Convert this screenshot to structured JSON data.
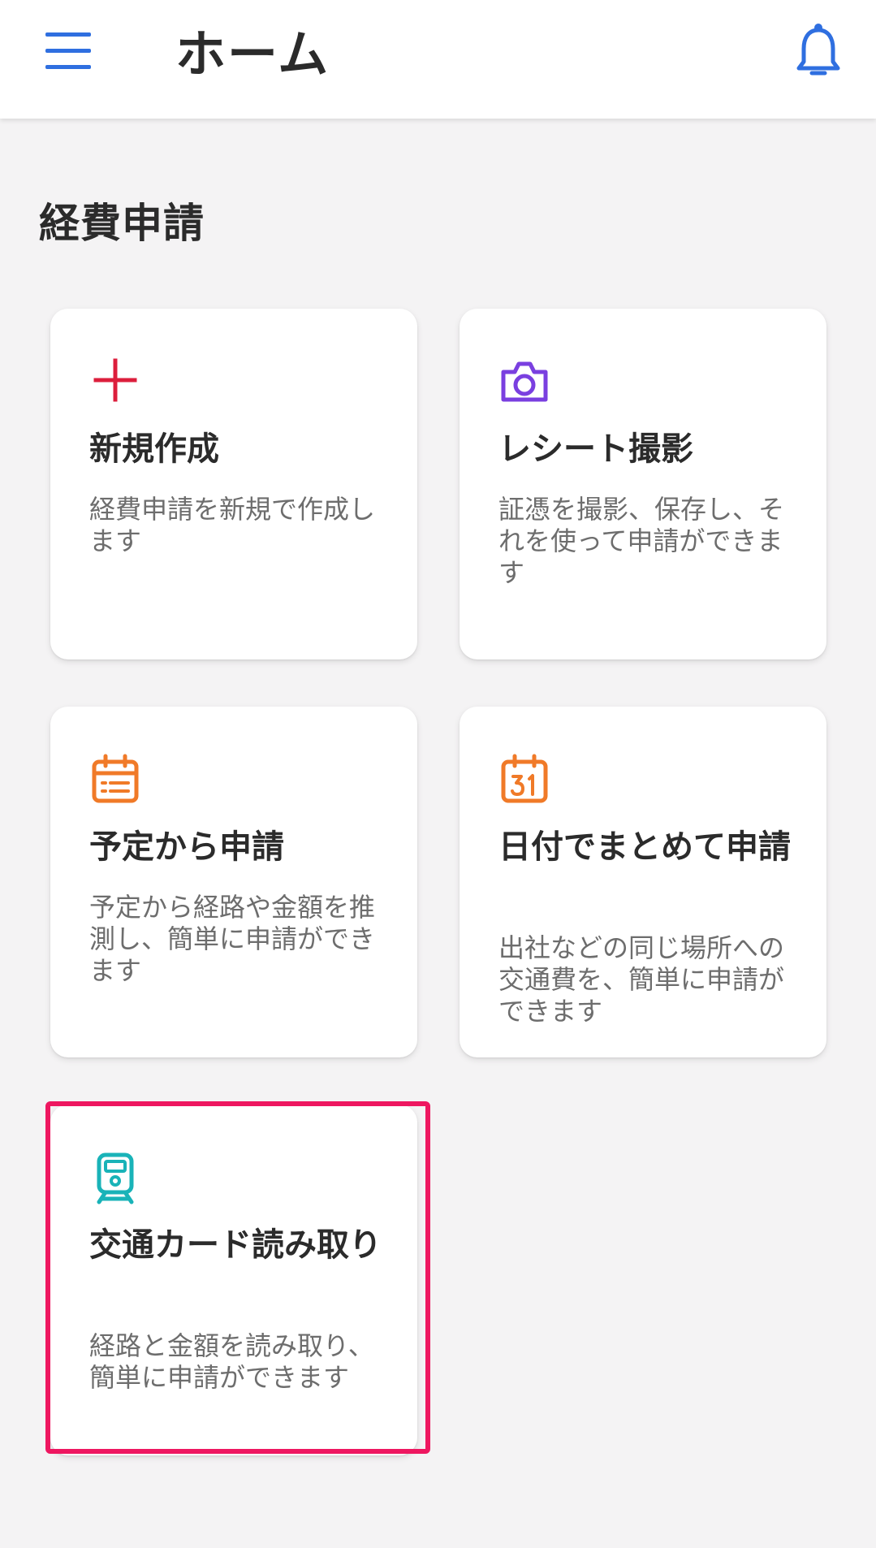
{
  "header": {
    "title": "ホーム",
    "menu_icon": "hamburger-menu-icon",
    "notification_icon": "bell-icon",
    "accent_color": "#2f6fe0"
  },
  "section": {
    "title": "経費申請"
  },
  "cards": [
    {
      "title": "新規作成",
      "description": "経費申請を新規で作成します",
      "icon": "plus-icon",
      "icon_color": "#dc1e3c"
    },
    {
      "title": "レシート撮影",
      "description": "証憑を撮影、保存し、それを使って申請ができます",
      "icon": "camera-icon",
      "icon_color": "#7a3fe0"
    },
    {
      "title": "予定から申請",
      "description": "予定から経路や金額を推測し、簡単に申請ができます",
      "icon": "calendar-icon",
      "icon_color": "#f07a28"
    },
    {
      "title": "日付でまとめて申請",
      "description": "出社などの同じ場所への交通費を、簡単に申請ができます",
      "icon": "calendar-31-icon",
      "icon_color": "#f07a28"
    },
    {
      "title": "交通カード読み取り",
      "description": "経路と金額を読み取り、簡単に申請ができます",
      "icon": "train-icon",
      "icon_color": "#19b3b8",
      "highlighted": true
    }
  ],
  "highlight_color": "#ee1760"
}
